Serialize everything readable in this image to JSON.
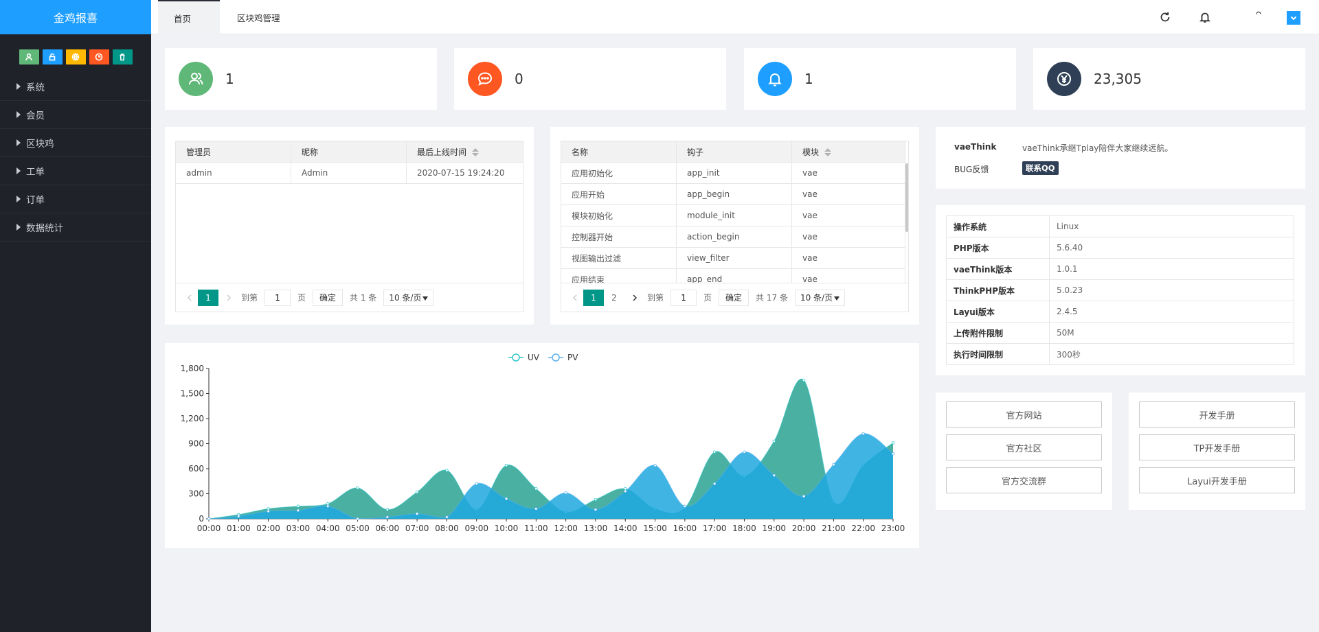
{
  "app": {
    "title": "金鸡报喜"
  },
  "sidebar": {
    "quick_icons": [
      {
        "name": "user-icon",
        "color": "#5fb878"
      },
      {
        "name": "lock-icon",
        "color": "#1e9fff"
      },
      {
        "name": "globe-icon",
        "color": "#ffb800"
      },
      {
        "name": "clock-icon",
        "color": "#ff5722"
      },
      {
        "name": "trash-icon",
        "color": "#009688"
      }
    ],
    "items": [
      {
        "label": "系统"
      },
      {
        "label": "会员"
      },
      {
        "label": "区块鸡"
      },
      {
        "label": "工单"
      },
      {
        "label": "订单"
      },
      {
        "label": "数据统计"
      }
    ]
  },
  "header": {
    "tabs": [
      {
        "label": "首页",
        "active": true
      },
      {
        "label": "区块鸡管理",
        "active": false
      }
    ],
    "icons": [
      "refresh-icon",
      "bell-icon",
      "dropdown-icon"
    ]
  },
  "stats": [
    {
      "value": "1",
      "icon": "users-icon",
      "color": "#5fb878"
    },
    {
      "value": "0",
      "icon": "chat-icon",
      "color": "#ff5722"
    },
    {
      "value": "1",
      "icon": "bell-icon",
      "color": "#1e9fff"
    },
    {
      "value": "23,305",
      "icon": "yen-icon",
      "color": "#2f4056"
    }
  ],
  "admin_table": {
    "headers": [
      "管理员",
      "昵称",
      "最后上线时间"
    ],
    "rows": [
      [
        "admin",
        "Admin",
        "2020-07-15 19:24:20"
      ]
    ],
    "pager": {
      "current": "1",
      "goto_label": "到第",
      "goto_value": "1",
      "page_label": "页",
      "confirm": "确定",
      "total": "共 1 条",
      "per_page": "10 条/页"
    }
  },
  "hooks_table": {
    "headers": [
      "名称",
      "钩子",
      "模块"
    ],
    "rows": [
      [
        "应用初始化",
        "app_init",
        "vae"
      ],
      [
        "应用开始",
        "app_begin",
        "vae"
      ],
      [
        "模块初始化",
        "module_init",
        "vae"
      ],
      [
        "控制器开始",
        "action_begin",
        "vae"
      ],
      [
        "视图输出过滤",
        "view_filter",
        "vae"
      ],
      [
        "应用结束",
        "app_end",
        "vae"
      ]
    ],
    "pager": {
      "current": "1",
      "next": "2",
      "goto_label": "到第",
      "goto_value": "1",
      "page_label": "页",
      "confirm": "确定",
      "total": "共 17 条",
      "per_page": "10 条/页"
    }
  },
  "about": {
    "name_label": "vaeThink",
    "name_value": "vaeThink承继Tplay陪伴大家继续远航。",
    "bug_label": "BUG反馈",
    "bug_button": "联系QQ"
  },
  "sysinfo": [
    {
      "k": "操作系统",
      "v": "Linux"
    },
    {
      "k": "PHP版本",
      "v": "5.6.40"
    },
    {
      "k": "vaeThink版本",
      "v": "1.0.1"
    },
    {
      "k": "ThinkPHP版本",
      "v": "5.0.23"
    },
    {
      "k": "Layui版本",
      "v": "2.4.5"
    },
    {
      "k": "上传附件限制",
      "v": "50M"
    },
    {
      "k": "执行时间限制",
      "v": "300秒"
    }
  ],
  "links_left": [
    "官方网站",
    "官方社区",
    "官方交流群"
  ],
  "links_right": [
    "开发手册",
    "TP开发手册",
    "Layui开发手册"
  ],
  "chart_data": {
    "type": "area",
    "x": [
      "00:00",
      "01:00",
      "02:00",
      "03:00",
      "04:00",
      "05:00",
      "06:00",
      "07:00",
      "08:00",
      "09:00",
      "10:00",
      "11:00",
      "12:00",
      "13:00",
      "14:00",
      "15:00",
      "16:00",
      "17:00",
      "18:00",
      "19:00",
      "20:00",
      "21:00",
      "22:00",
      "23:00"
    ],
    "series": [
      {
        "name": "UV",
        "color": "#2ec7c9",
        "fill": "#3aa99a",
        "values": [
          0,
          50,
          120,
          150,
          180,
          370,
          110,
          320,
          580,
          110,
          640,
          360,
          80,
          230,
          360,
          120,
          130,
          800,
          510,
          930,
          1660,
          210,
          640,
          910
        ]
      },
      {
        "name": "PV",
        "color": "#5ab1ef",
        "fill": "#1ea8df",
        "values": [
          0,
          30,
          90,
          100,
          150,
          0,
          20,
          60,
          20,
          420,
          240,
          120,
          310,
          110,
          330,
          640,
          150,
          420,
          800,
          520,
          270,
          650,
          1020,
          780
        ]
      }
    ],
    "ylim": [
      0,
      1800
    ],
    "yticks": [
      "0",
      "300",
      "600",
      "900",
      "1,200",
      "1,500",
      "1,800"
    ],
    "legend_position": "top"
  }
}
